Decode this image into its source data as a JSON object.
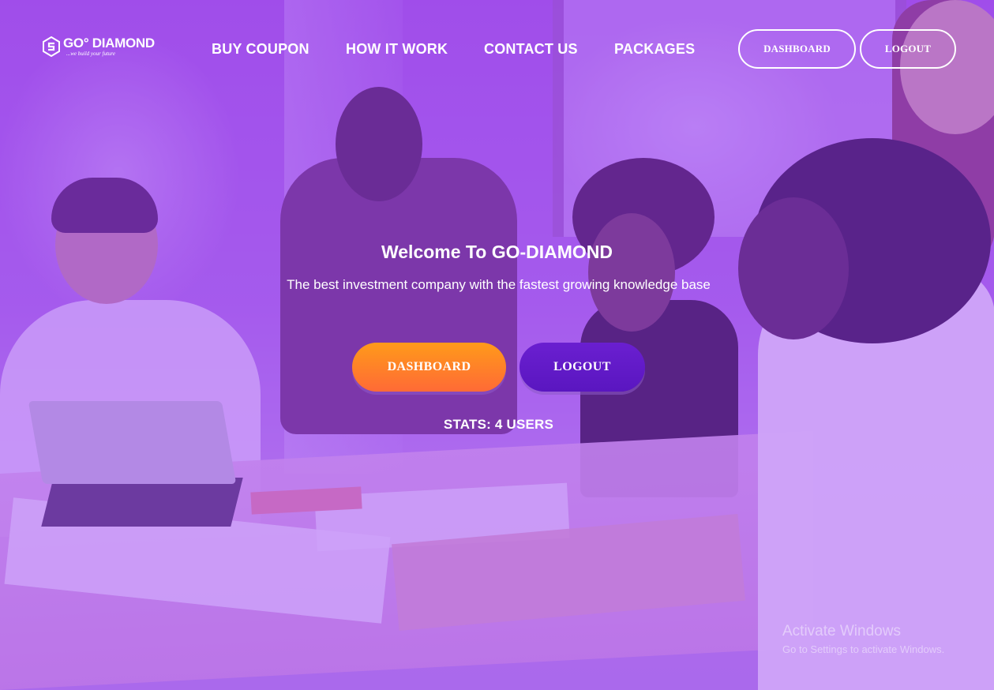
{
  "brand": {
    "name": "GO° DIAMOND",
    "tagline": "...we build your future",
    "icon": "diamond-s-logo-icon"
  },
  "nav": {
    "links": [
      {
        "label": "BUY COUPON"
      },
      {
        "label": "HOW IT WORK"
      },
      {
        "label": "CONTACT US"
      },
      {
        "label": "PACKAGES"
      }
    ],
    "dashboard_label": "DASHBOARD",
    "logout_label": "LOGOUT"
  },
  "hero": {
    "title": "Welcome To GO-DIAMOND",
    "subtitle": "The best investment company with the fastest growing knowledge base",
    "dashboard_label": "DASHBOARD",
    "logout_label": "LOGOUT",
    "stats": "STATS: 4 USERS"
  },
  "watermark": {
    "title": "Activate Windows",
    "subtitle": "Go to Settings to activate Windows."
  },
  "colors": {
    "overlay": "#9a3cf0",
    "cta_dashboard_top": "#ff9a1a",
    "cta_dashboard_bottom": "#ff6a36",
    "cta_logout": "#5f18c8",
    "text": "#ffffff"
  }
}
